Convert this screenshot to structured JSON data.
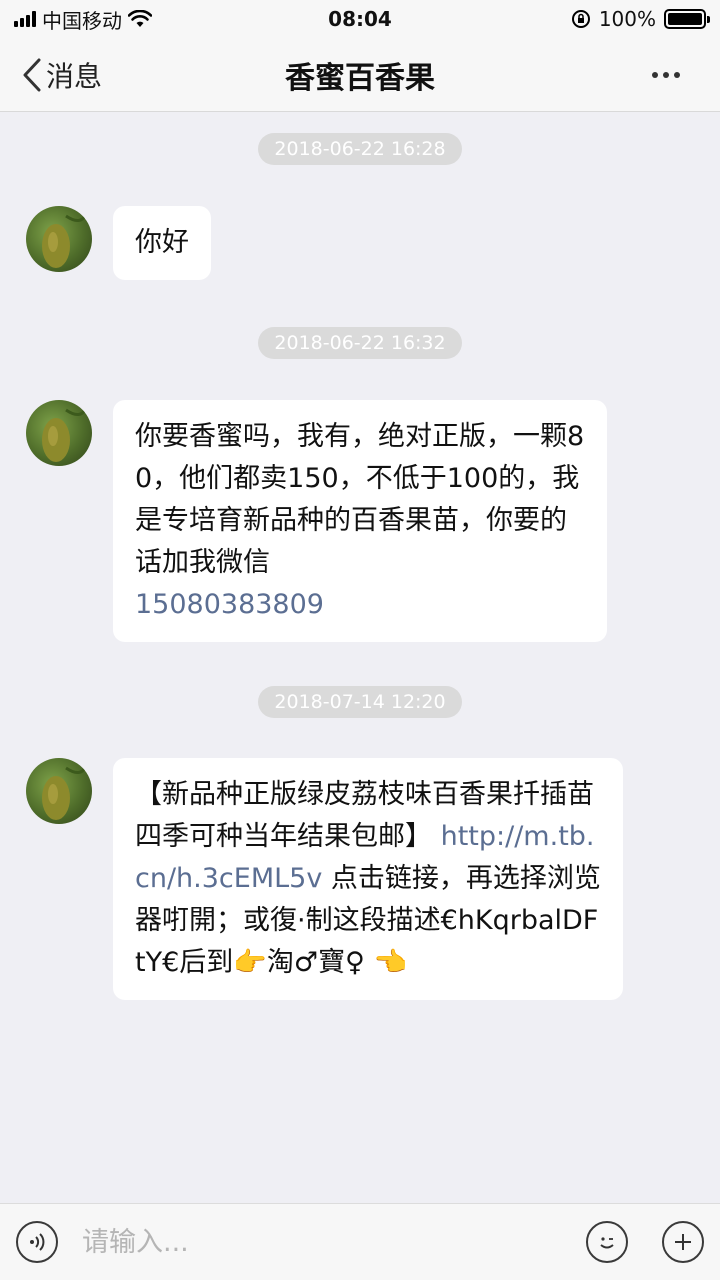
{
  "status_bar": {
    "carrier": "中国移动",
    "time": "08:04",
    "battery_text": "100%",
    "battery_level": 1.0
  },
  "nav": {
    "back_label": "消息",
    "title": "香蜜百香果"
  },
  "messages": [
    {
      "timestamp": "2018-06-22 16:28",
      "text": "你好",
      "link": ""
    },
    {
      "timestamp": "2018-06-22 16:32",
      "text": "你要香蜜吗，我有，绝对正版，一颗80，他们都卖150，不低于100的，我是专培育新品种的百香果苗，你要的话加我微信",
      "link": "15080383809"
    },
    {
      "timestamp": "2018-07-14 12:20",
      "text_before": "【新品种正版绿皮荔枝味百香果扦插苗  四季可种当年结果包邮】",
      "link": "http://m.tb.cn/h.3cEML5v",
      "text_after": " 点击链接，再选择浏览器咑開；或復·制这段描述€hKqrbalDFtY€后到👉淘♂寶♀ 👈"
    }
  ],
  "input": {
    "placeholder": "请输入..."
  },
  "icons": {
    "back": "chevron-left-icon",
    "more": "more-icon",
    "voice": "voice-icon",
    "emoji": "emoji-icon",
    "add": "plus-icon"
  },
  "colors": {
    "link": "#5b6e92",
    "background": "#efeff4",
    "bubble": "#ffffff",
    "timestamp_bg": "#dadada"
  }
}
